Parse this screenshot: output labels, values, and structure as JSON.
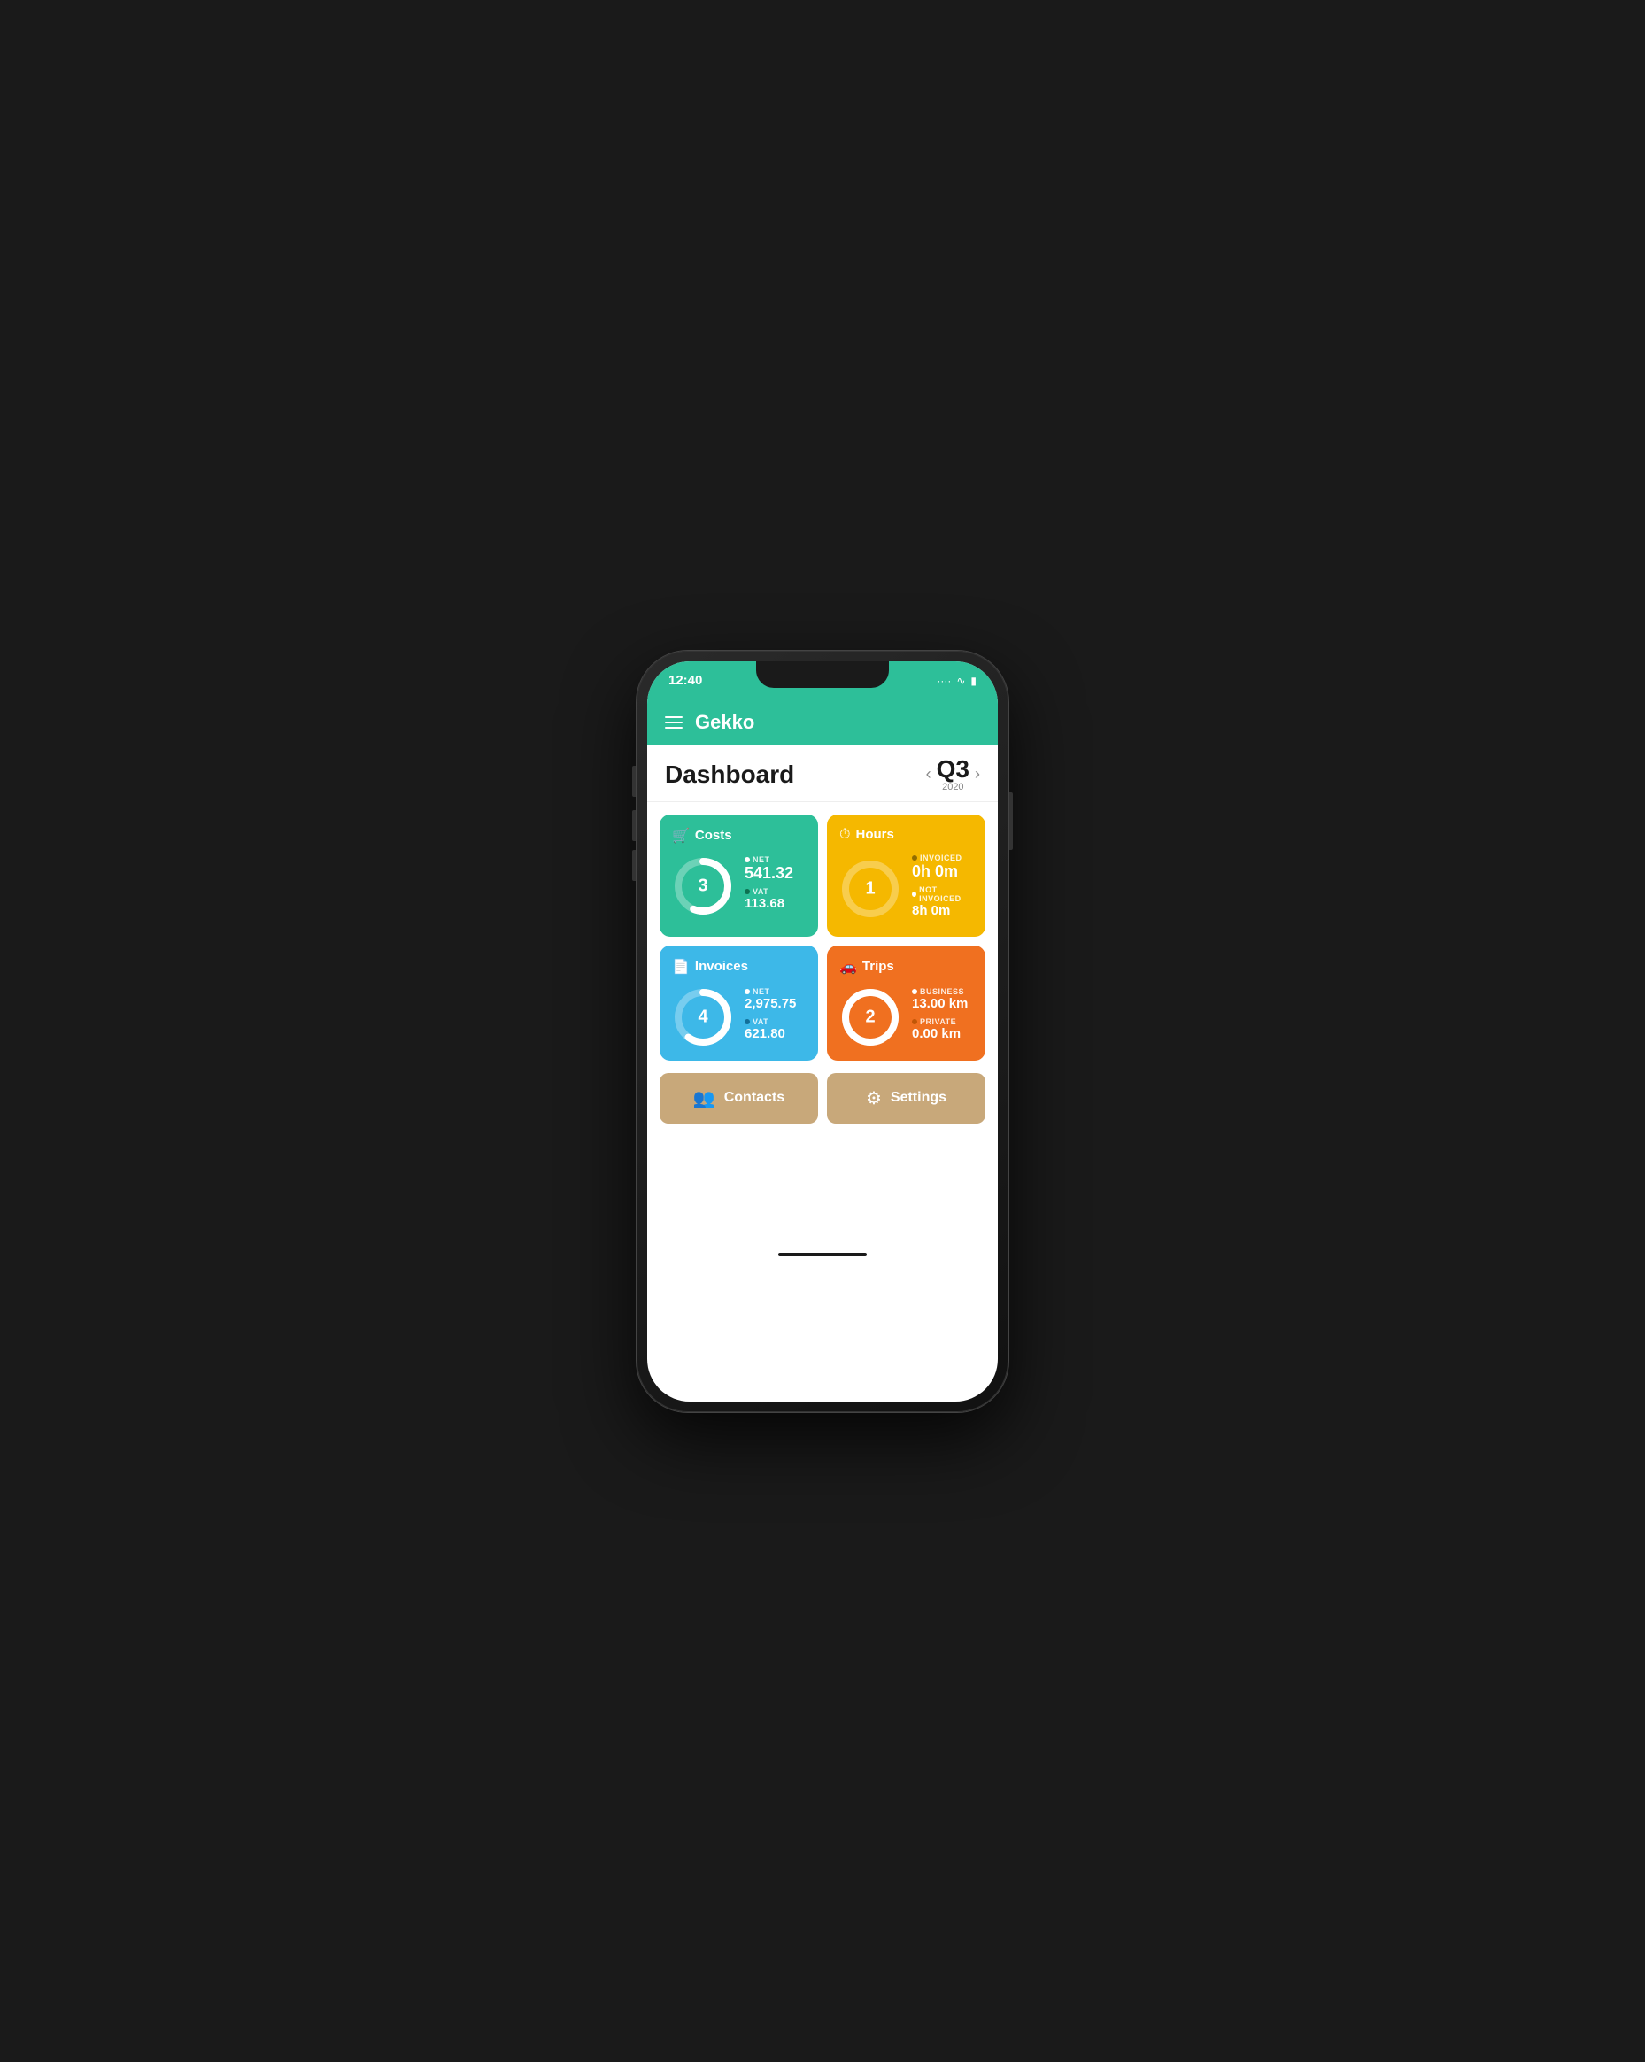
{
  "status": {
    "time": "12:40",
    "icons": [
      "···",
      "WiFi",
      "Battery"
    ]
  },
  "header": {
    "menu_icon": "≡",
    "app_name": "Gekko"
  },
  "dashboard": {
    "title": "Dashboard",
    "period": {
      "quarter": "Q3",
      "year": "2020",
      "prev_arrow": "‹",
      "next_arrow": "›"
    }
  },
  "cards": {
    "costs": {
      "title": "Costs",
      "icon": "🛒",
      "count": "3",
      "net_label": "NET",
      "net_value": "541.32",
      "vat_label": "VAT",
      "vat_value": "113.68",
      "donut_value": 75,
      "donut_color": "#1a7a60",
      "bg_color": "#2dbf99"
    },
    "hours": {
      "title": "Hours",
      "icon": "⏱",
      "count": "1",
      "invoiced_label": "INVOICED",
      "invoiced_value": "0h 0m",
      "not_invoiced_label": "NOT INVOICED",
      "not_invoiced_value": "8h 0m",
      "donut_value": 0,
      "donut_color": "#a07a00",
      "bg_color": "#f5b800"
    },
    "invoices": {
      "title": "Invoices",
      "icon": "📄",
      "count": "4",
      "net_label": "NET",
      "net_value": "2,975.75",
      "vat_label": "VAT",
      "vat_value": "621.80",
      "donut_value": 80,
      "donut_color": "#1a7aaa",
      "bg_color": "#3db8e8"
    },
    "trips": {
      "title": "Trips",
      "icon": "🚗",
      "count": "2",
      "business_label": "BUSINESS",
      "business_value": "13.00 km",
      "private_label": "PRIVATE",
      "private_value": "0.00 km",
      "donut_value": 100,
      "donut_color": "#fff",
      "bg_color": "#f07020"
    }
  },
  "buttons": {
    "contacts": {
      "label": "Contacts",
      "icon": "👥"
    },
    "settings": {
      "label": "Settings",
      "icon": "⚙"
    }
  }
}
